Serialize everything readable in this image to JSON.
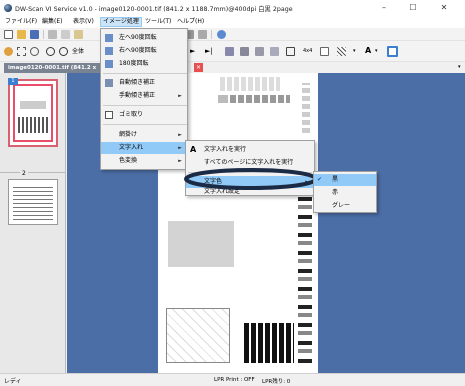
{
  "window": {
    "title": "DW-Scan VI Service v1.0 - image0120-0001.tif (841.2 x 1188.7mm)@400dpi 白黒 2page",
    "minimize": "–",
    "maximize": "☐",
    "close": "✕"
  },
  "menubar": [
    "ファイル(F)",
    "編集(E)",
    "表示(V)",
    "イメージ処理",
    "ツール(T)",
    "ヘルプ(H)"
  ],
  "toolbar2": {
    "zoom_label": "全体"
  },
  "tab": {
    "label": "image0120-0001.tif (841.2 x"
  },
  "thumbnails": {
    "page1_num": "1",
    "page2_num": "2"
  },
  "image_menu": {
    "items": [
      "左へ90度回転",
      "右へ90度回転",
      "180度回転",
      "自動傾き補正",
      "手動傾き補正",
      "ゴミ取り",
      "網掛け",
      "文字入れ",
      "色変換"
    ]
  },
  "text_submenu": {
    "items": [
      "文字入れを実行",
      "すべてのページに文字入れを実行",
      "文字色",
      "文字入れ設定"
    ],
    "icon_letter": "A"
  },
  "color_submenu": {
    "items": [
      "黒",
      "赤",
      "グレー"
    ],
    "checked": "✔"
  },
  "statusbar": {
    "ready": "レディ",
    "print_status": "LPR Print : OFF",
    "remaining": "LPR残り: 0"
  },
  "colors": {
    "viewer_bg": "#4c6ea7",
    "menu_highlight": "#91c9f7",
    "tab_bg": "#7a8391",
    "annotation_ellipse": "#1b2a45"
  }
}
